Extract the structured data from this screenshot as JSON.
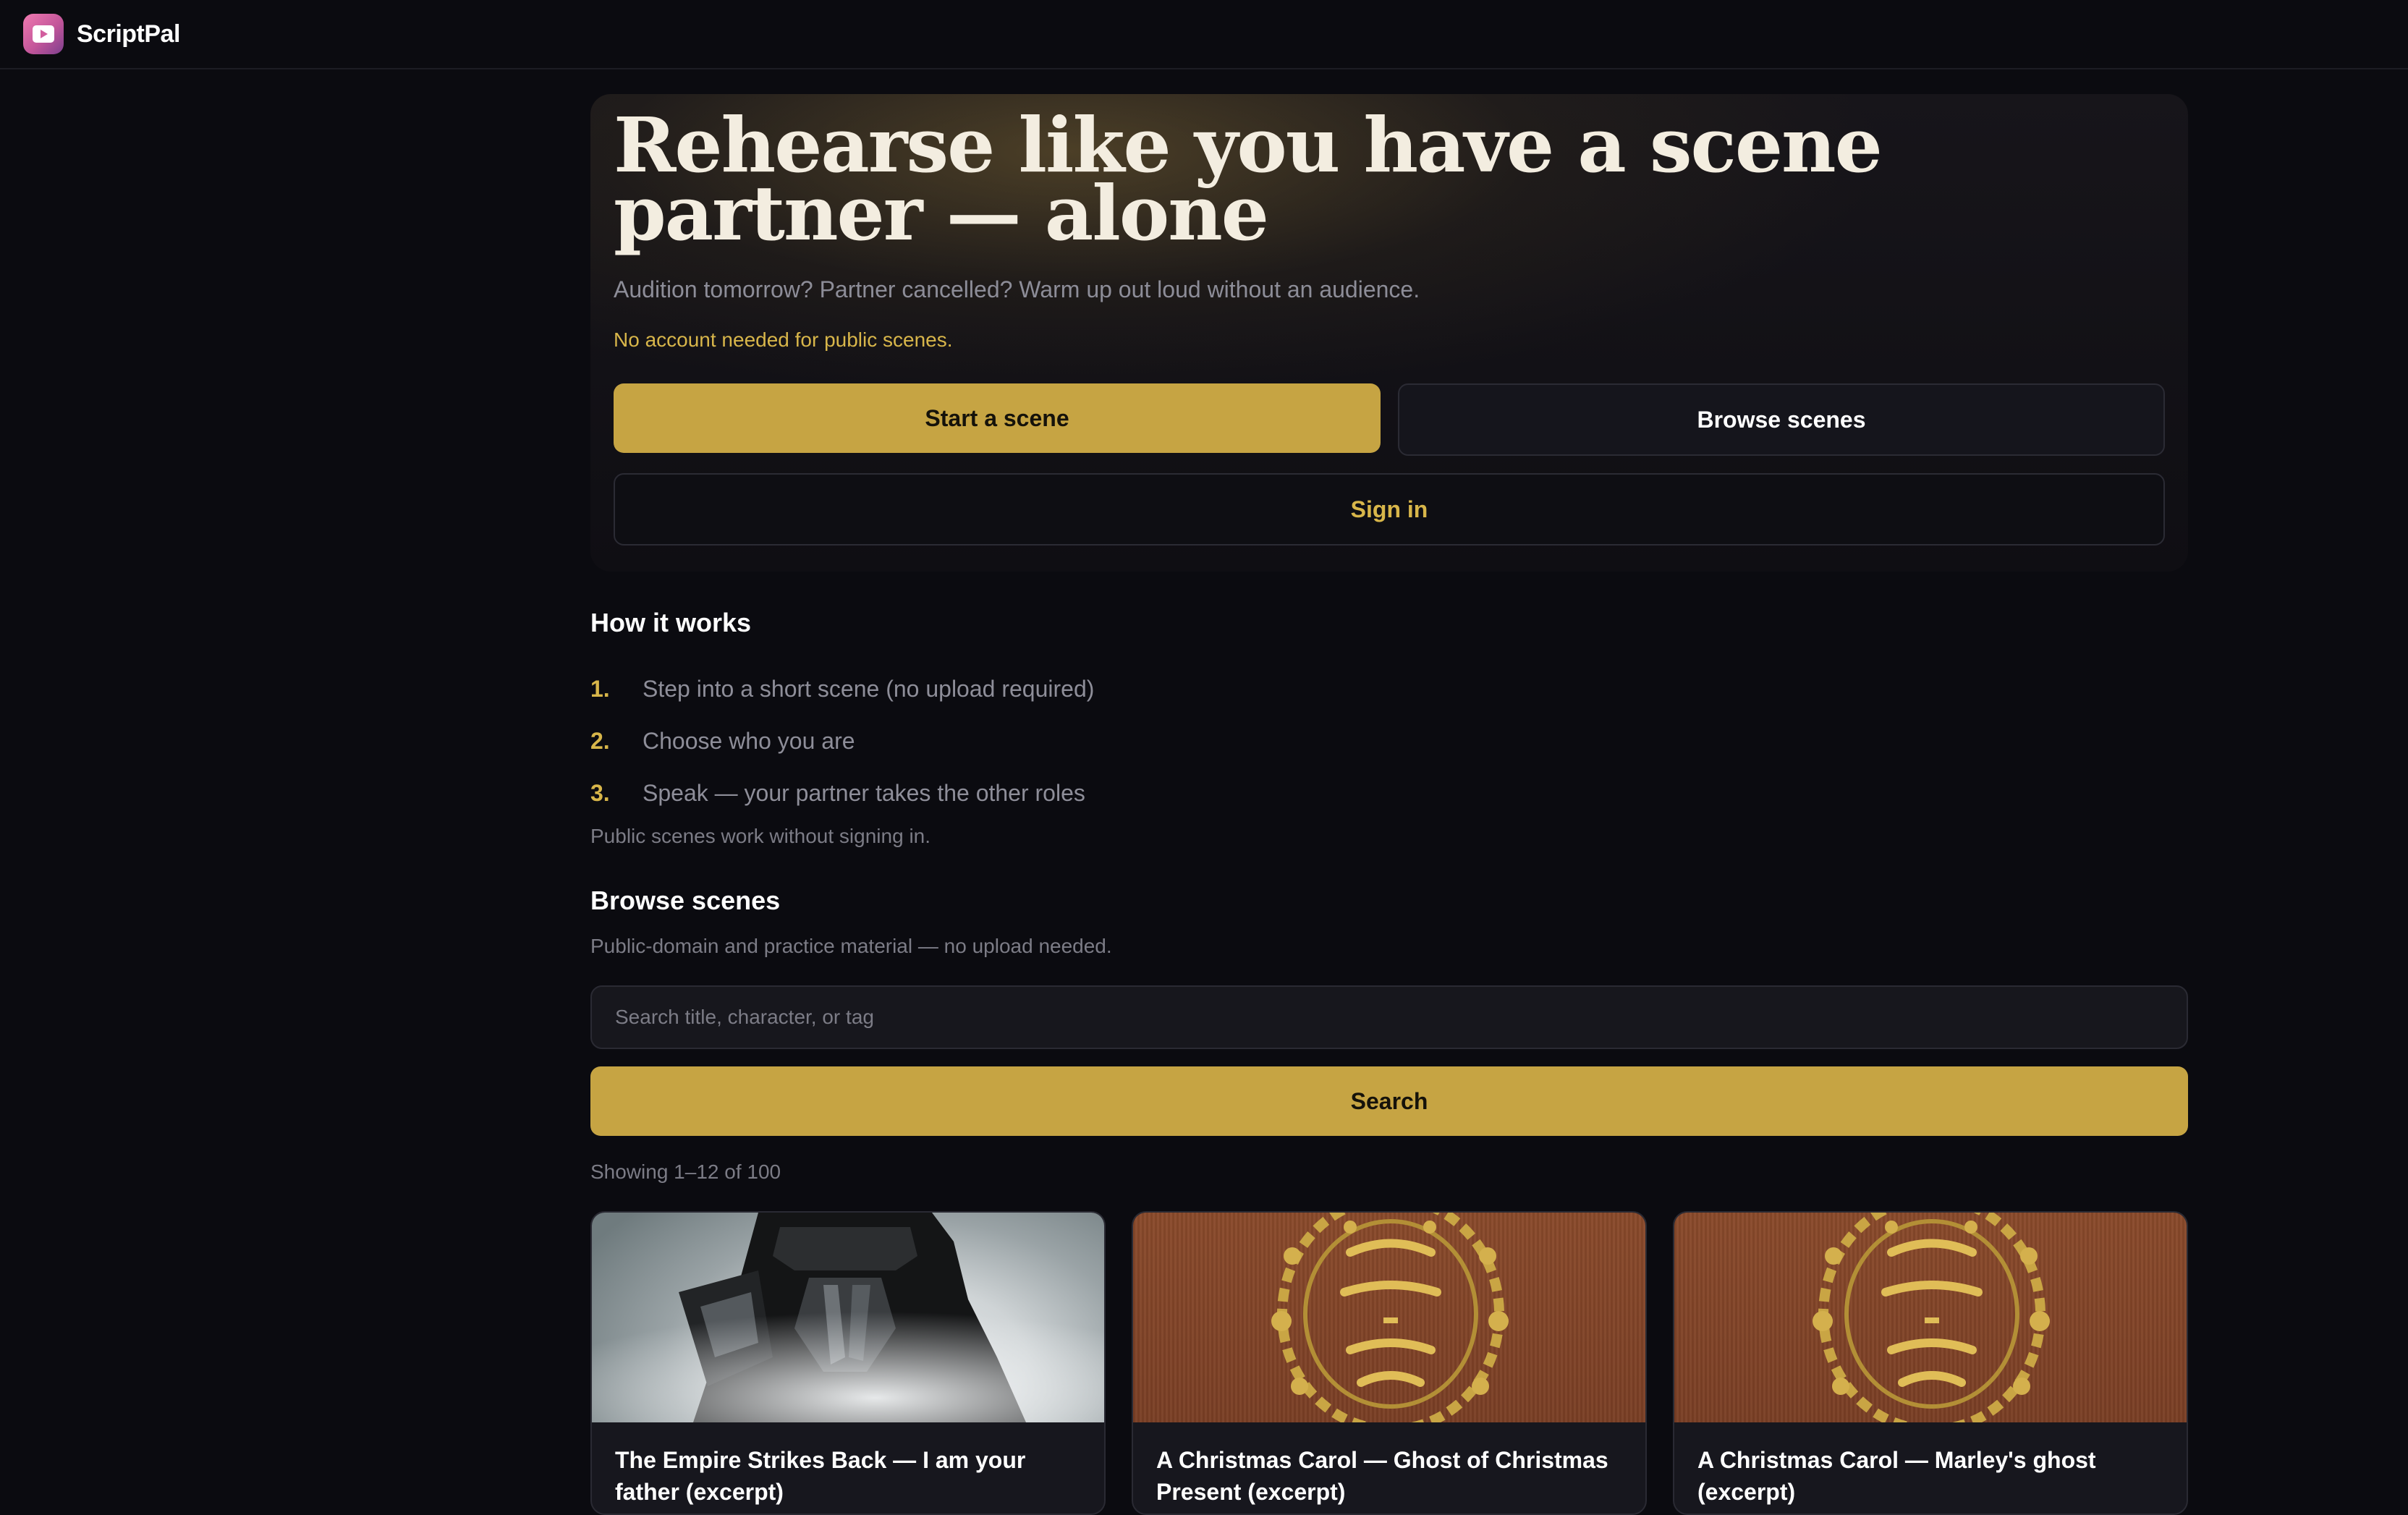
{
  "app": {
    "name": "ScriptPal",
    "logo_icon": "play-icon",
    "accent": "#c6a443"
  },
  "hero": {
    "title": "Rehearse like you have a scene partner — alone",
    "subtitle": "Audition tomorrow? Partner cancelled? Warm up out loud without an audience.",
    "note": "No account needed for public scenes.",
    "start_label": "Start a scene",
    "browse_label": "Browse scenes",
    "signin_label": "Sign in"
  },
  "how": {
    "title": "How it works",
    "steps": [
      {
        "num": "1.",
        "text": "Step into a short scene (no upload required)"
      },
      {
        "num": "2.",
        "text": "Choose who you are"
      },
      {
        "num": "3.",
        "text": "Speak — your partner takes the other roles"
      }
    ],
    "footnote": "Public scenes work without signing in."
  },
  "browse": {
    "title": "Browse scenes",
    "subtitle": "Public-domain and practice material — no upload needed.",
    "search_placeholder": "Search title, character, or tag",
    "search_label": "Search",
    "results_text": "Showing 1–12 of 100",
    "cards": [
      {
        "title": "The Empire Strikes Back — I am your father (excerpt)",
        "thumb": "armored-figure-in-smoke"
      },
      {
        "title": "A Christmas Carol — Ghost of Christmas Present (excerpt)",
        "thumb": "christmas-carol-book-cover"
      },
      {
        "title": "A Christmas Carol — Marley's ghost (excerpt)",
        "thumb": "christmas-carol-book-cover"
      }
    ]
  }
}
